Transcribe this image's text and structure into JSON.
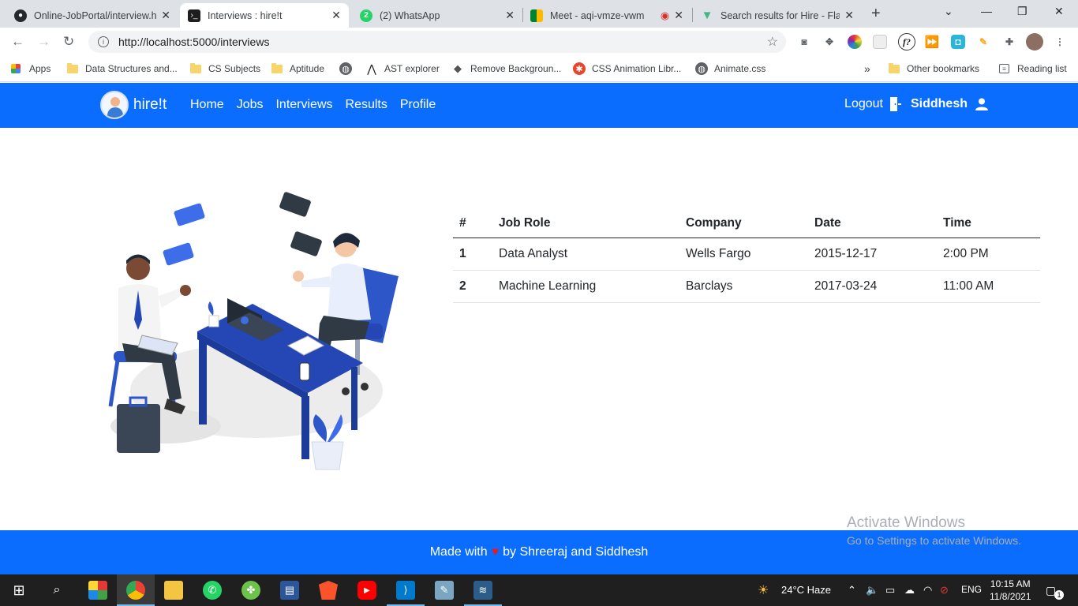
{
  "browser": {
    "tabs": [
      {
        "title": "Online-JobPortal/interview.h",
        "icon": "github-icon"
      },
      {
        "title": "Interviews : hire!t",
        "icon": "terminal-icon",
        "active": true
      },
      {
        "title": "(2) WhatsApp",
        "icon": "whatsapp-icon",
        "badge": "2"
      },
      {
        "title": "Meet - aqi-vmze-vwm",
        "icon": "google-meet-icon"
      },
      {
        "title": "Search results for Hire - Flat",
        "icon": "vuetify-icon"
      }
    ],
    "url": "http://localhost:5000/interviews",
    "bookmarks": [
      {
        "label": "Apps",
        "icon": "apps-grid-icon"
      },
      {
        "label": "Data Structures and...",
        "icon": "folder-icon"
      },
      {
        "label": "CS Subjects",
        "icon": "folder-icon"
      },
      {
        "label": "Aptitude",
        "icon": "folder-icon"
      },
      {
        "label": "",
        "icon": "globe-icon"
      },
      {
        "label": "AST explorer",
        "icon": "ast-icon"
      },
      {
        "label": "Remove Backgroun...",
        "icon": "layers-icon"
      },
      {
        "label": "CSS Animation Libr...",
        "icon": "css-anim-icon"
      },
      {
        "label": "Animate.css",
        "icon": "globe-icon"
      }
    ],
    "bookmarks_more": "»",
    "other_bookmarks": "Other bookmarks",
    "reading_list": "Reading list"
  },
  "app": {
    "brand": "hire!t",
    "nav": [
      "Home",
      "Jobs",
      "Interviews",
      "Results",
      "Profile"
    ],
    "logout_label": "Logout",
    "username": "Siddhesh",
    "table": {
      "headers": [
        "#",
        "Job Role",
        "Company",
        "Date",
        "Time"
      ],
      "rows": [
        [
          "1",
          "Data Analyst",
          "Wells Fargo",
          "2015-12-17",
          "2:00 PM"
        ],
        [
          "2",
          "Machine Learning",
          "Barclays",
          "2017-03-24",
          "11:00 AM"
        ]
      ]
    },
    "footer": {
      "prefix": "Made with",
      "heart": "♥",
      "suffix": "by Shreeraj and Siddhesh"
    }
  },
  "watermark": {
    "line1": "Activate Windows",
    "line2": "Go to Settings to activate Windows."
  },
  "taskbar": {
    "weather": "24°C  Haze",
    "language": "ENG",
    "time": "10:15 AM",
    "date": "11/8/2021",
    "notification_count": "1"
  },
  "colors": {
    "primary": "#0b6dfd",
    "heart": "#e51c23"
  }
}
